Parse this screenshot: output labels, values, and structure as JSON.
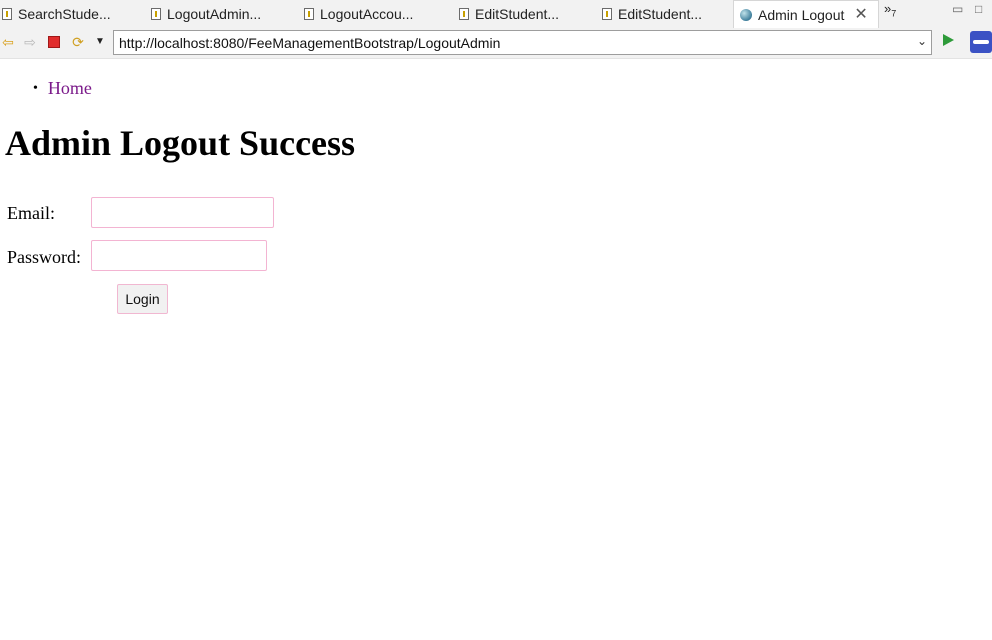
{
  "tabs": [
    {
      "label": "SearchStude..."
    },
    {
      "label": "LogoutAdmin..."
    },
    {
      "label": "LogoutAccou..."
    },
    {
      "label": "EditStudent..."
    },
    {
      "label": "EditStudent..."
    },
    {
      "label": "Admin Logout",
      "active": true
    }
  ],
  "tab_overflow_count": "7",
  "address_bar": {
    "url": "http://localhost:8080/FeeManagementBootstrap/LogoutAdmin"
  },
  "nav": {
    "home_link": "Home"
  },
  "page_title": "Admin Logout Success",
  "form": {
    "email_label": "Email:",
    "email_value": "",
    "password_label": "Password:",
    "password_value": "",
    "login_button": "Login"
  },
  "colors": {
    "link": "#7b1a8a",
    "input_border": "#f3b4d2"
  },
  "icons": [
    "file-icon",
    "globe-icon",
    "close-icon",
    "back-arrow-icon",
    "forward-arrow-icon",
    "stop-icon",
    "refresh-icon",
    "dropdown-icon",
    "go-icon",
    "eclipse-icon"
  ]
}
